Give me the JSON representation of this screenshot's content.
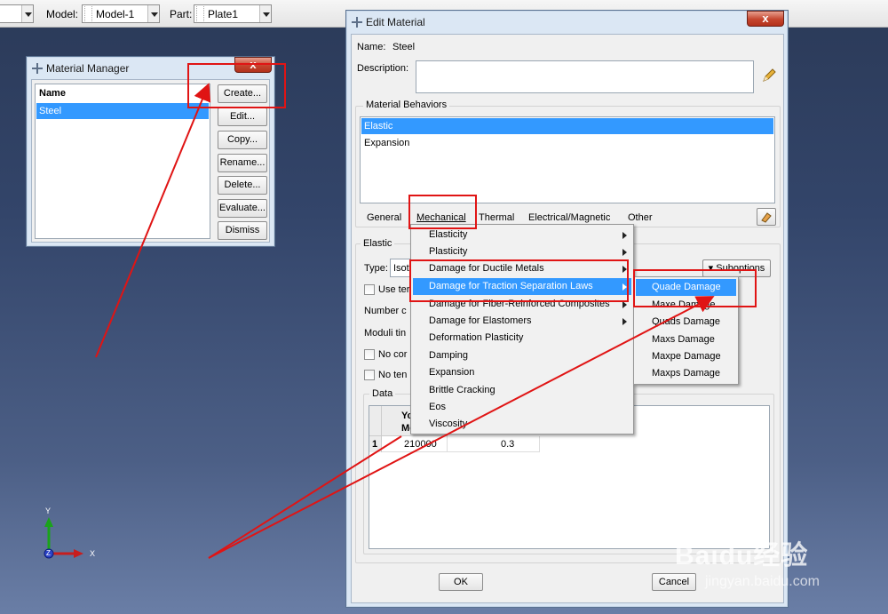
{
  "toolbar": {
    "combo0": "",
    "model_label": "Model:",
    "model_value": "Model-1",
    "part_label": "Part:",
    "part_value": "Plate1"
  },
  "material_manager": {
    "title": "Material Manager",
    "close": "x",
    "column_header": "Name",
    "materials": [
      "Steel"
    ],
    "buttons": {
      "create": "Create...",
      "edit": "Edit...",
      "copy": "Copy...",
      "rename": "Rename...",
      "delete": "Delete...",
      "evaluate": "Evaluate...",
      "dismiss": "Dismiss"
    }
  },
  "edit_material": {
    "title": "Edit Material",
    "close": "x",
    "name_label": "Name:",
    "name_value": "Steel",
    "description_label": "Description:",
    "description_value": "",
    "behaviors_label": "Material Behaviors",
    "behaviors": [
      "Elastic",
      "Expansion"
    ],
    "menubar": [
      "General",
      "Mechanical",
      "Thermal",
      "Electrical/Magnetic",
      "Other"
    ],
    "section_label": "Elastic",
    "type_label": "Type:",
    "type_value": "Isot",
    "suboptions": "Suboptions",
    "use_temp": "Use ter",
    "number_label": "Number c",
    "moduli_label": "Moduli tin",
    "no_comp": "No cor",
    "no_tens": "No ten",
    "data_label": "Data",
    "table": {
      "headers": [
        "Yo",
        "Mo"
      ],
      "header_line1": "Yo",
      "header_line2": "Mo",
      "row_number": "1",
      "youngs": "210000",
      "poisson": "0.3"
    },
    "ok": "OK",
    "cancel": "Cancel"
  },
  "mechanical_menu": [
    "Elasticity",
    "Plasticity",
    "Damage for Ductile Metals",
    "Damage for Traction Separation Laws",
    "Damage for Fiber-Reinforced Composites",
    "Damage for Elastomers",
    "Deformation Plasticity",
    "Damping",
    "Expansion",
    "Brittle Cracking",
    "Eos",
    "Viscosity"
  ],
  "damage_submenu": [
    "Quade Damage",
    "Maxe Damage",
    "Quads Damage",
    "Maxs Damage",
    "Maxpe Damage",
    "Maxps Damage"
  ],
  "triad": {
    "y": "Y",
    "z": "Z",
    "x": "X"
  },
  "watermark": {
    "brand": "Baidu经验",
    "url": "jingyan.baidu.com"
  },
  "colors": {
    "selection": "#3399ff",
    "annotation": "#e01414",
    "viewport": "#33456a"
  }
}
